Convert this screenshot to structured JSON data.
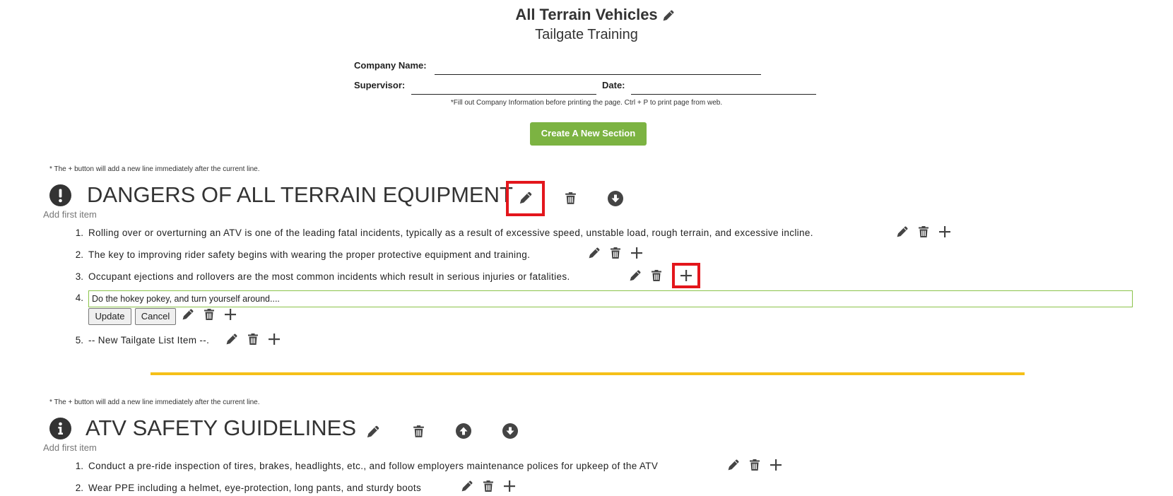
{
  "header": {
    "title": "All Terrain Vehicles",
    "subtitle": "Tailgate Training"
  },
  "form": {
    "company_label": "Company Name:",
    "supervisor_label": "Supervisor:",
    "date_label": "Date:",
    "print_note": "*Fill out Company Information before printing the page. Ctrl + P to print page from web."
  },
  "create_section_label": "Create A New Section",
  "plus_note": "* The + button will add a new line immediately after the current line.",
  "sections": [
    {
      "icon": "exclamation-icon",
      "title": "DANGERS OF ALL TERRAIN EQUIPMENT",
      "add_first": "Add first item",
      "items": [
        {
          "num": "1.",
          "text": "Rolling over or overturning an ATV is one of the leading fatal incidents, typically as a result of excessive speed, unstable load, rough terrain, and excessive incline."
        },
        {
          "num": "2.",
          "text": "The key to improving rider safety begins with wearing the proper protective equipment and training."
        },
        {
          "num": "3.",
          "text": "Occupant ejections and rollovers are the most common incidents which result in serious injuries or fatalities."
        },
        {
          "num": "4.",
          "edit_value": "Do the hokey pokey, and turn yourself around...."
        },
        {
          "num": "5.",
          "text": "-- New Tailgate List Item --."
        }
      ],
      "update_label": "Update",
      "cancel_label": "Cancel"
    },
    {
      "icon": "info-icon",
      "title": "ATV SAFETY GUIDELINES",
      "add_first": "Add first item",
      "items": [
        {
          "num": "1.",
          "text": "Conduct a pre-ride inspection of tires, brakes, headlights, etc., and follow employers maintenance polices for upkeep of the ATV"
        },
        {
          "num": "2.",
          "text": "Wear PPE including a helmet, eye-protection, long pants, and sturdy boots"
        }
      ]
    }
  ],
  "colors": {
    "accent_green": "#7cb342",
    "highlight_red": "#e3161c",
    "divider_yellow": "#f5c018",
    "icon_dark": "#333333"
  }
}
